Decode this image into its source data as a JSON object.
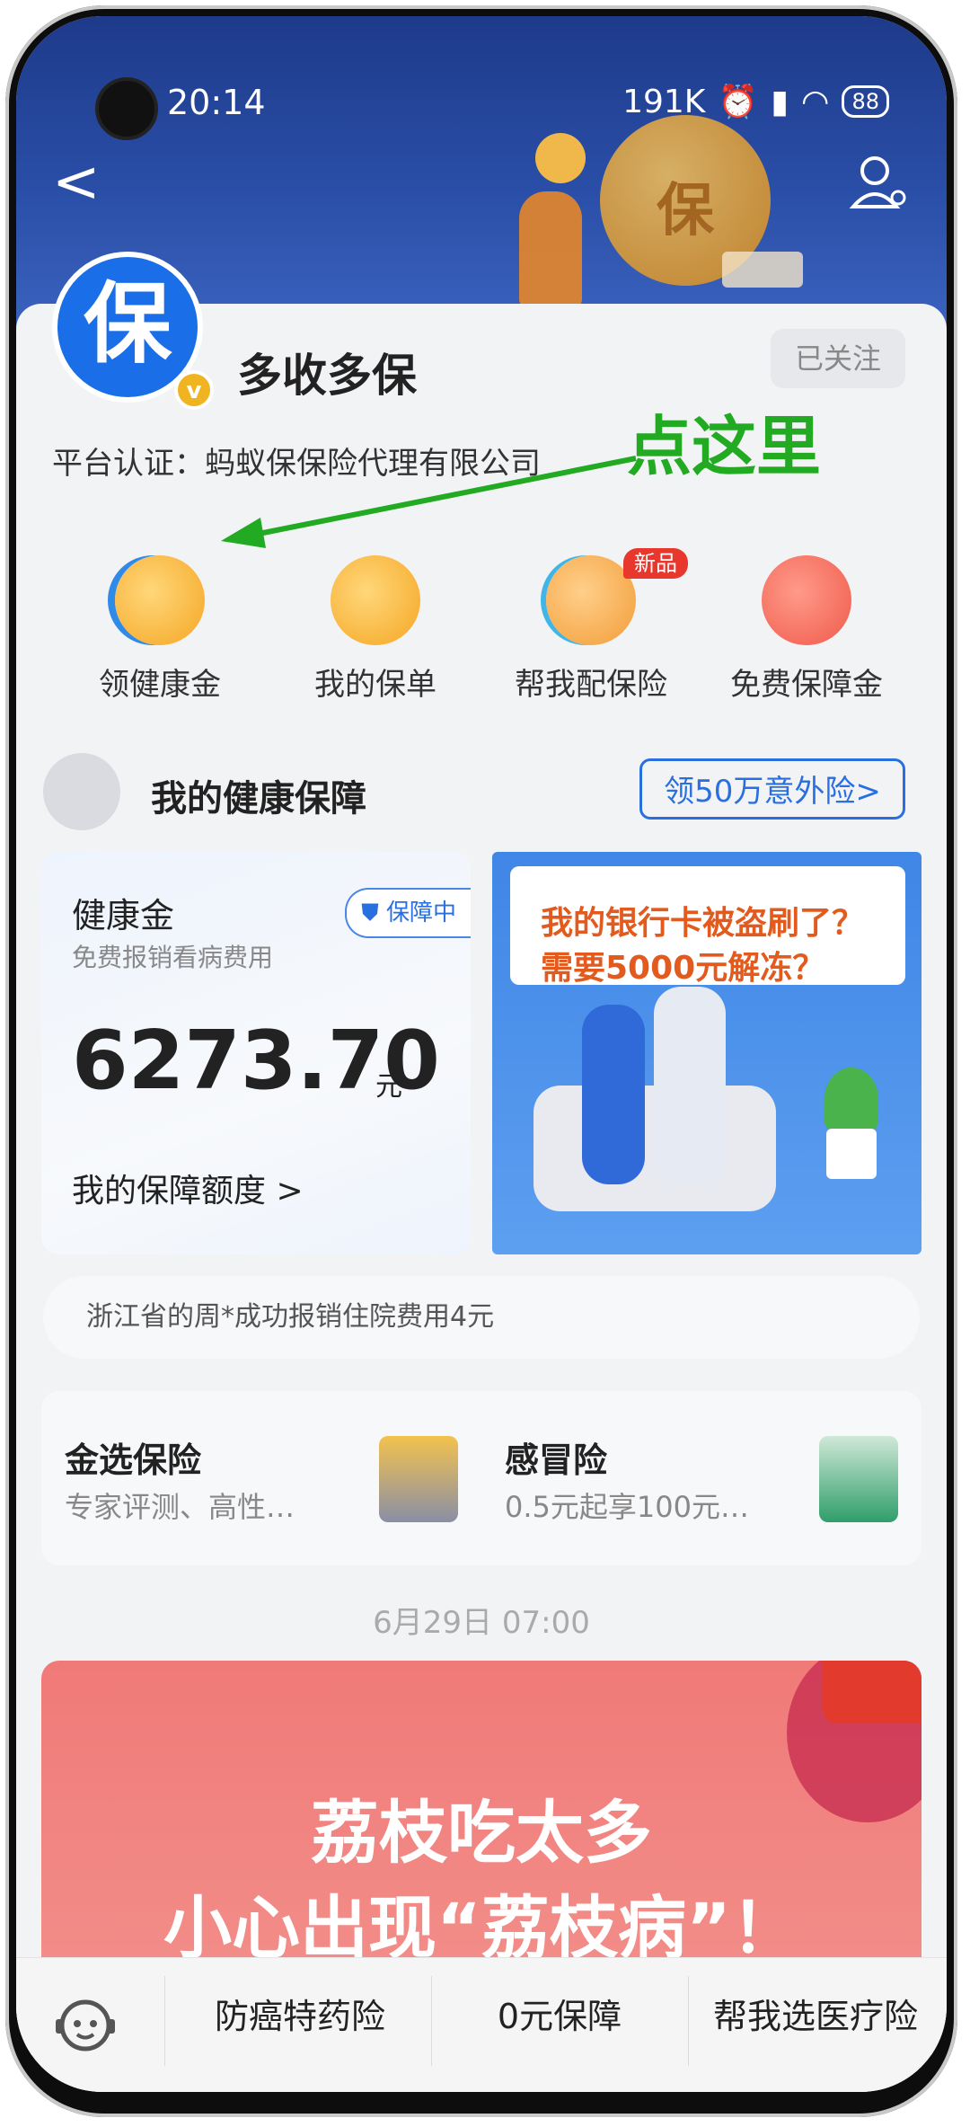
{
  "status_bar": {
    "time": "20:14",
    "net_speed": "191K",
    "battery": "88"
  },
  "header": {
    "back_label": "<"
  },
  "profile": {
    "logo_char": "保",
    "verified_mark": "v",
    "title": "多收多保",
    "follow_label": "已关注",
    "certification": "平台认证：蚂蚁保保险代理有限公司"
  },
  "annotation": {
    "text": "点这里",
    "color": "#22aa22"
  },
  "shortcuts": [
    {
      "label": "领健康金",
      "icon": "heart-coin-icon",
      "color": "#f5a623"
    },
    {
      "label": "我的保单",
      "icon": "policy-document-icon",
      "color": "#f5a623"
    },
    {
      "label": "帮我配保险",
      "icon": "money-bag-icon",
      "color": "#f29d38",
      "badge": "新品"
    },
    {
      "label": "免费保障金",
      "icon": "gift-box-icon",
      "color": "#f05a4a"
    }
  ],
  "section": {
    "title": "我的健康保障",
    "cta": "领50万意外险>"
  },
  "health_card": {
    "title": "健康金",
    "subtitle": "免费报销看病费用",
    "badge": "保障中",
    "amount": "6273.70",
    "unit": "元",
    "link": "我的保障额度 >"
  },
  "ad_card": {
    "line1": "我的银行卡被盗刷了？",
    "line2": "需要5000元解冻？"
  },
  "ticker": "浙江省的周*成功报销住院费用4元",
  "products": [
    {
      "title": "金选保险",
      "subtitle": "专家评测、高性…",
      "icon": "trophy-icon"
    },
    {
      "title": "感冒险",
      "subtitle": "0.5元起享100元…",
      "icon": "insurance-card-icon"
    }
  ],
  "feed_date": "6月29日 07:00",
  "promo": {
    "line1": "荔枝吃太多",
    "line2": "小心出现“荔枝病”！"
  },
  "bottom_bar": {
    "assistant_icon": "robot-assistant-icon",
    "items": [
      "防癌特药险",
      "0元保障",
      "帮我选医疗险"
    ]
  },
  "colors": {
    "brand_blue": "#1a6fe8",
    "accent_orange": "#e35a1e",
    "banner_navy": "#1e3a8a"
  }
}
